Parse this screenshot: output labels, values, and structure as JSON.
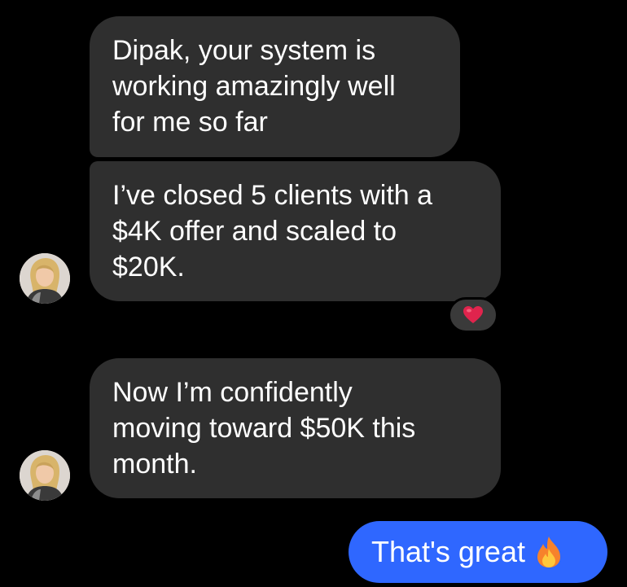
{
  "messages": [
    {
      "text": "Dipak, your system is\nworking amazingly well\nfor me so far"
    },
    {
      "text": "I’ve closed 5 clients with a\n$4K offer and scaled to\n$20K."
    },
    {
      "text": "Now I’m confidently\nmoving toward $50K this\nmonth."
    }
  ],
  "reaction": {
    "icon": "heart-icon",
    "color": "#e0244d"
  },
  "sent_message": {
    "text": "That's great",
    "icon": "fire-icon"
  },
  "colors": {
    "background": "#000000",
    "received_bubble": "#2f2f2f",
    "sent_bubble": "#2f67ff"
  }
}
